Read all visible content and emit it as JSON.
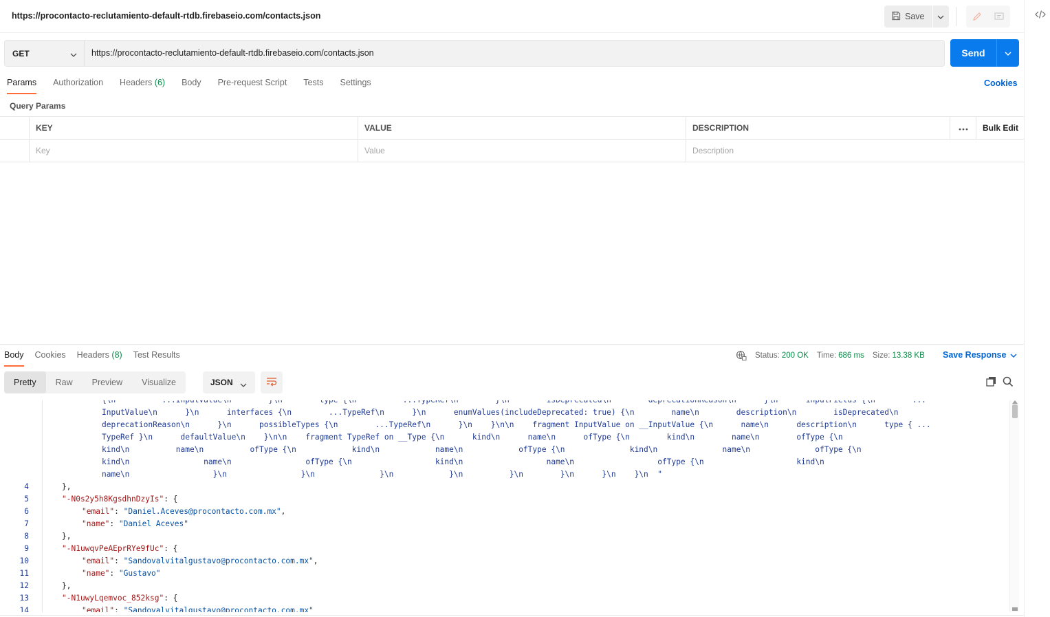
{
  "request": {
    "title": "https://procontacto-reclutamiento-default-rtdb.firebaseio.com/contacts.json",
    "save_label": "Save",
    "method": "GET",
    "url": "https://procontacto-reclutamiento-default-rtdb.firebaseio.com/contacts.json",
    "send_label": "Send"
  },
  "req_tabs": {
    "params": "Params",
    "authorization": "Authorization",
    "headers": "Headers",
    "headers_count": "(6)",
    "body": "Body",
    "prerequest": "Pre-request Script",
    "tests": "Tests",
    "settings": "Settings",
    "cookies": "Cookies"
  },
  "query_params": {
    "title": "Query Params",
    "columns": {
      "key": "KEY",
      "value": "VALUE",
      "description": "DESCRIPTION",
      "bulk_edit": "Bulk Edit"
    },
    "placeholders": {
      "key": "Key",
      "value": "Value",
      "description": "Description"
    }
  },
  "response": {
    "tabs": {
      "body": "Body",
      "cookies": "Cookies",
      "headers": "Headers",
      "headers_count": "(8)",
      "test_results": "Test Results"
    },
    "status_label": "Status:",
    "status_value": "200 OK",
    "time_label": "Time:",
    "time_value": "686 ms",
    "size_label": "Size:",
    "size_value": "13.38 KB",
    "save_response": "Save Response",
    "views": {
      "pretty": "Pretty",
      "raw": "Raw",
      "preview": "Preview",
      "visualize": "Visualize"
    },
    "format": "JSON"
  },
  "code": {
    "wrapped_lines": [
      "{\\n          ...InputValue\\n        }\\n        type {\\n          ...TypeRef\\n        }\\n        isDeprecated\\n        deprecationReason\\n      }\\n      inputFields {\\n        ...",
      "InputValue\\n      }\\n      interfaces {\\n        ...TypeRef\\n      }\\n      enumValues(includeDeprecated: true) {\\n        name\\n        description\\n        isDeprecated\\n",
      "deprecationReason\\n      }\\n      possibleTypes {\\n        ...TypeRef\\n      }\\n    }\\n\\n    fragment InputValue on __InputValue {\\n      name\\n      description\\n      type { ...",
      "TypeRef }\\n      defaultValue\\n    }\\n\\n    fragment TypeRef on __Type {\\n      kind\\n      name\\n      ofType {\\n        kind\\n        name\\n        ofType {\\n",
      "kind\\n          name\\n          ofType {\\n            kind\\n            name\\n            ofType {\\n              kind\\n              name\\n              ofType {\\n",
      "kind\\n                name\\n                ofType {\\n                  kind\\n                  name\\n                  ofType {\\n                    kind\\n",
      "name\\n                  }\\n                }\\n              }\\n            }\\n          }\\n        }\\n      }\\n    }\\n  \""
    ],
    "lines": [
      {
        "n": "4",
        "indent": 0,
        "text": "},"
      },
      {
        "n": "5",
        "indent": 0,
        "key": "\"-N0s2y5h8KgsdhnDzyIs\"",
        "rest": ": {"
      },
      {
        "n": "6",
        "indent": 1,
        "key": "\"email\"",
        "sep": ": ",
        "val": "\"Daniel.Aceves@procontacto.com.mx\"",
        "tail": ","
      },
      {
        "n": "7",
        "indent": 1,
        "key": "\"name\"",
        "sep": ": ",
        "val": "\"Daniel Aceves\"",
        "tail": ""
      },
      {
        "n": "8",
        "indent": 0,
        "text": "},"
      },
      {
        "n": "9",
        "indent": 0,
        "key": "\"-N1uwqvPeAEprRYe9fUc\"",
        "rest": ": {"
      },
      {
        "n": "10",
        "indent": 1,
        "key": "\"email\"",
        "sep": ": ",
        "val": "\"Sandovalvitalgustavo@procontacto.com.mx\"",
        "tail": ","
      },
      {
        "n": "11",
        "indent": 1,
        "key": "\"name\"",
        "sep": ": ",
        "val": "\"Gustavo\"",
        "tail": ""
      },
      {
        "n": "12",
        "indent": 0,
        "text": "},"
      },
      {
        "n": "13",
        "indent": 0,
        "key": "\"-N1uwyLqemvoc_852ksg\"",
        "rest": ": {"
      },
      {
        "n": "14",
        "indent": 1,
        "key": "\"email\"",
        "sep": ": ",
        "val": "\"Sandovalvitalgustavo@procontacto.com.mx\"",
        "tail": ""
      }
    ]
  },
  "colors": {
    "accent_orange": "#ff6c37",
    "send_blue": "#097bed",
    "link_blue": "#0265d2",
    "status_green": "#0d8a4a",
    "json_key": "#a31515",
    "json_string": "#0451a5"
  }
}
